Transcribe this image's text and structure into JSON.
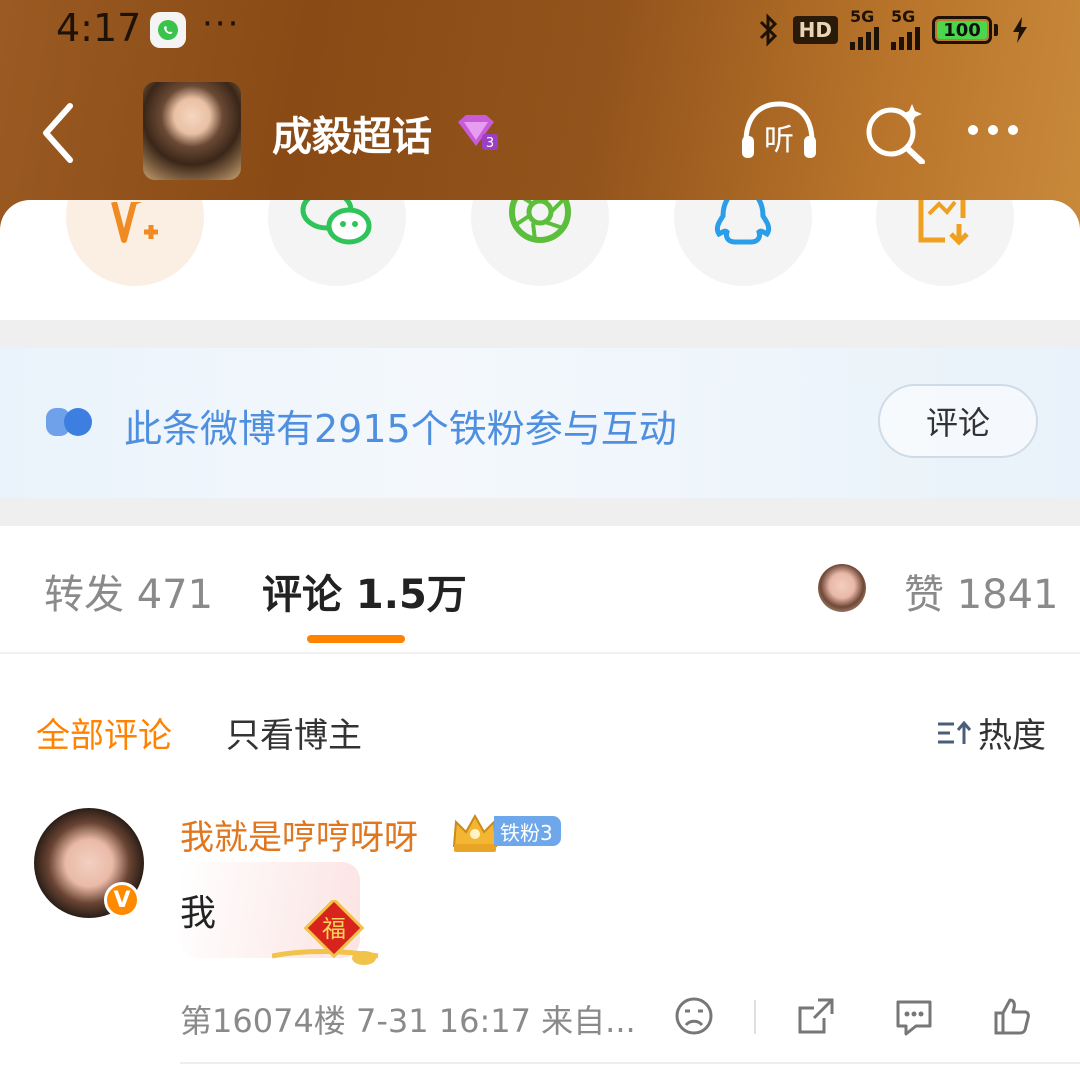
{
  "status_bar": {
    "time": "4:17",
    "more": "···",
    "hd": "HD",
    "network1": "5G",
    "network2": "5G",
    "battery": "100"
  },
  "header": {
    "topic_title": "成毅超话",
    "listen_label": "听"
  },
  "share_row": {
    "items": [
      "weibo-compose-icon",
      "wechat-icon",
      "moments-icon",
      "qq-icon",
      "save-image-icon"
    ]
  },
  "fan_banner": {
    "text": "此条微博有2915个铁粉参与互动",
    "button": "评论"
  },
  "tabs": {
    "forward": "转发 471",
    "comment": "评论 1.5万",
    "like": "赞 1841"
  },
  "filter": {
    "all": "全部评论",
    "owner_only": "只看博主",
    "sort": "热度"
  },
  "comment": {
    "username": "我就是哼哼呀呀",
    "fan_badge": "铁粉3",
    "verify": "V",
    "text": "我",
    "meta": "第16074楼  7-31 16:17  来自..."
  },
  "colors": {
    "accent_orange": "#ff8200",
    "fan_blue": "#4f8fe0",
    "username_orange": "#e0761d"
  }
}
